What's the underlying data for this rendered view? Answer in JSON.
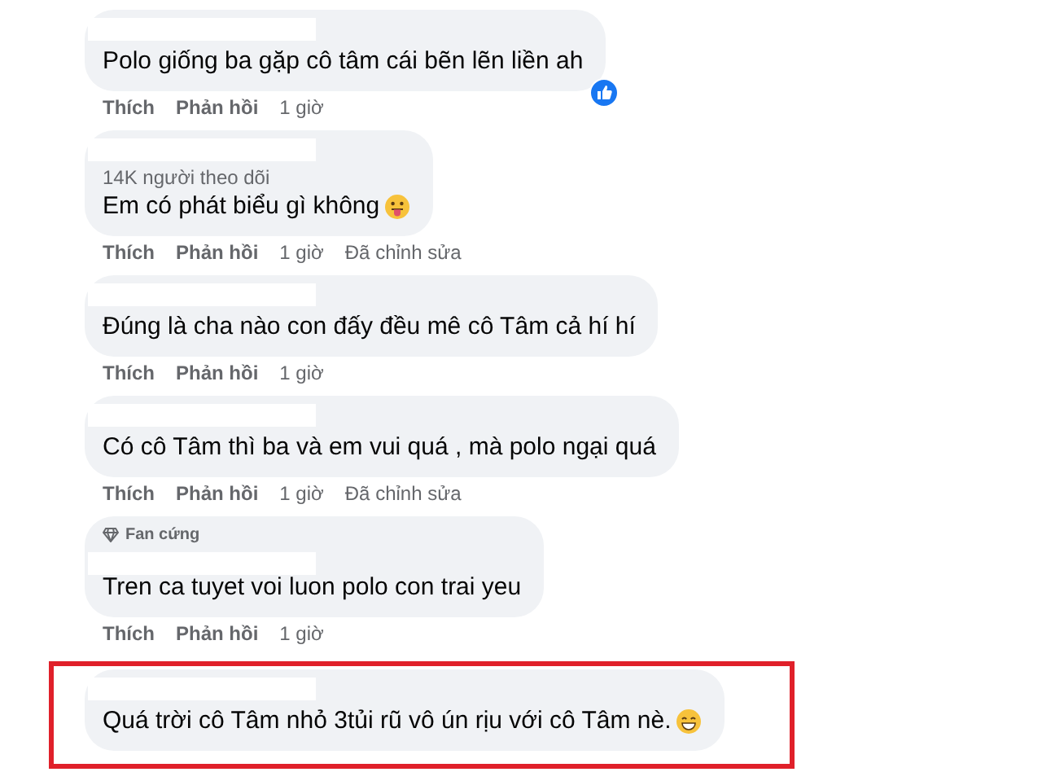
{
  "comments": [
    {
      "text": "Polo giống ba gặp cô tâm cái bẽn lẽn liền ah",
      "tongue_emoji": false,
      "grin_emoji": false,
      "liked": true,
      "like_label": "Thích",
      "reply_label": "Phản hồi",
      "time": "1 giờ",
      "highlighted": false
    },
    {
      "followers": "14K người theo dõi",
      "text": "Em có phát biểu gì không",
      "tongue_emoji": true,
      "grin_emoji": false,
      "liked": false,
      "like_label": "Thích",
      "reply_label": "Phản hồi",
      "time": "1 giờ",
      "edited": "Đã chỉnh sửa",
      "highlighted": false
    },
    {
      "text": "Đúng là cha nào con đấy đều mê cô Tâm cả hí hí",
      "tongue_emoji": false,
      "grin_emoji": false,
      "liked": false,
      "like_label": "Thích",
      "reply_label": "Phản hồi",
      "time": "1 giờ",
      "highlighted": false
    },
    {
      "text": "Có cô Tâm thì ba và em vui quá , mà polo ngại quá",
      "tongue_emoji": false,
      "grin_emoji": false,
      "liked": false,
      "like_label": "Thích",
      "reply_label": "Phản hồi",
      "time": "1 giờ",
      "edited": "Đã chỉnh sửa",
      "highlighted": false
    },
    {
      "badge": "Fan cứng",
      "text": "Tren ca tuyet voi luon polo con trai yeu",
      "tongue_emoji": false,
      "grin_emoji": false,
      "liked": false,
      "like_label": "Thích",
      "reply_label": "Phản hồi",
      "time": "1 giờ",
      "highlighted": false
    },
    {
      "text": "Quá trời cô Tâm nhỏ 3tủi rũ vô ún rịu với cô Tâm nè.",
      "tongue_emoji": false,
      "grin_emoji": true,
      "liked": false,
      "highlighted": true
    }
  ]
}
